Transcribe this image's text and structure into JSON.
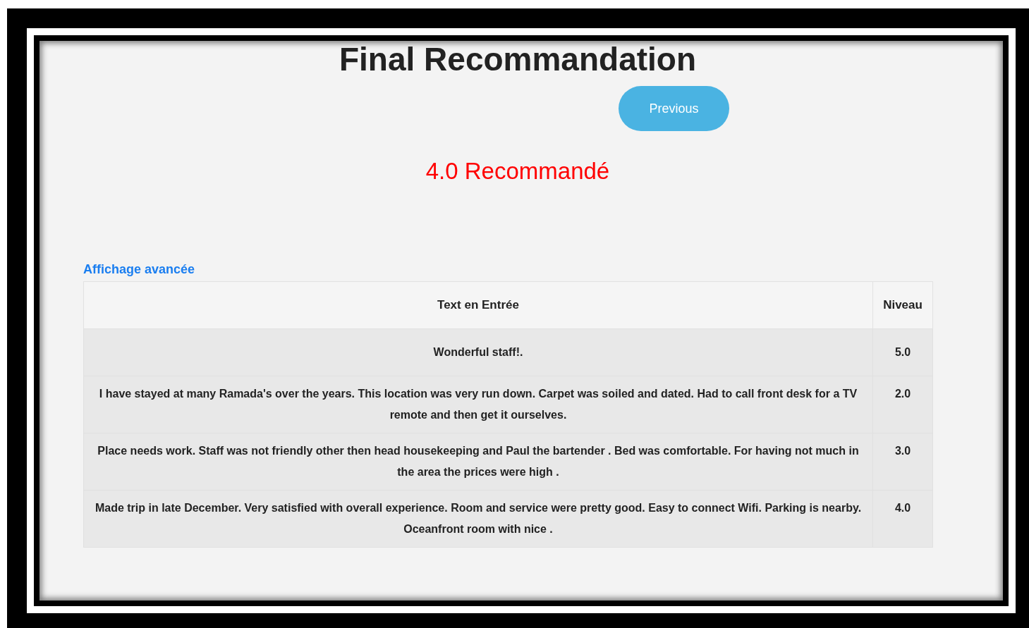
{
  "title": "Final Recommandation",
  "previous_button": "Previous",
  "result": "4.0 Recommandé",
  "advanced_link": "Affichage avancée",
  "table": {
    "columns": [
      "Text en Entrée",
      "Niveau"
    ],
    "rows": [
      {
        "text": "Wonderful staff!.",
        "level": "5.0"
      },
      {
        "text": "I have stayed at many Ramada's over the years. This location was very run down. Carpet was soiled and dated. Had to call front desk for a TV remote and then get it ourselves.",
        "level": "2.0"
      },
      {
        "text": "Place needs work. Staff was not friendly other then head housekeeping and Paul the bartender . Bed was comfortable. For having not much in the area the prices were high .",
        "level": "3.0"
      },
      {
        "text": "Made trip in late December. Very satisfied with overall experience. Room and service were pretty good. Easy to connect Wifi. Parking is nearby. Oceanfront room with nice .",
        "level": "4.0"
      }
    ]
  }
}
